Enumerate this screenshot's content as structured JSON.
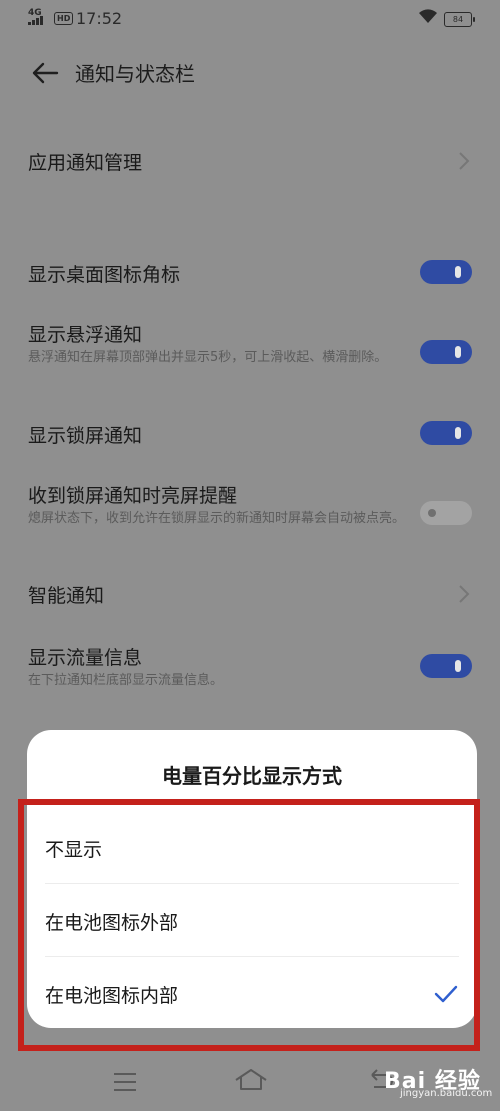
{
  "status_bar": {
    "network": "4G",
    "hd": "HD",
    "time": "17:52",
    "battery": "84"
  },
  "header": {
    "title": "通知与状态栏"
  },
  "rows": {
    "app_notification": {
      "title": "应用通知管理"
    },
    "desktop_badge": {
      "title": "显示桌面图标角标",
      "on": true
    },
    "floating": {
      "title": "显示悬浮通知",
      "subtitle": "悬浮通知在屏幕顶部弹出并显示5秒，可上滑收起、横滑删除。",
      "on": true
    },
    "lock_screen": {
      "title": "显示锁屏通知",
      "on": true
    },
    "wake_screen": {
      "title": "收到锁屏通知时亮屏提醒",
      "subtitle": "熄屏状态下，收到允许在锁屏显示的新通知时屏幕会自动被点亮。",
      "on": false
    },
    "smart": {
      "title": "智能通知"
    },
    "traffic": {
      "title": "显示流量信息",
      "subtitle": "在下拉通知栏底部显示流量信息。",
      "on": true
    }
  },
  "sheet": {
    "title": "电量百分比显示方式",
    "options": [
      {
        "label": "不显示",
        "selected": false
      },
      {
        "label": "在电池图标外部",
        "selected": false
      },
      {
        "label": "在电池图标内部",
        "selected": true
      }
    ]
  },
  "watermark": {
    "brand": "Bai 经验",
    "url": "jingyan.baidu.com"
  },
  "colors": {
    "accent": "#2f4ba3",
    "highlight_border": "#c4211b",
    "check": "#2f5fcf"
  }
}
